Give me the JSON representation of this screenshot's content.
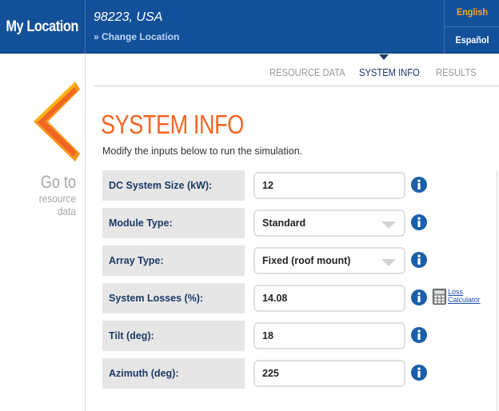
{
  "header": {
    "brand": "My Location",
    "location": "98223, USA",
    "change_location": "» Change Location",
    "languages": [
      "English",
      "Español"
    ]
  },
  "nav": {
    "back_big": "Go to",
    "back_small_1": "resource",
    "back_small_2": "data"
  },
  "tabs": [
    {
      "label": "RESOURCE DATA",
      "active": false
    },
    {
      "label": "SYSTEM INFO",
      "active": true
    },
    {
      "label": "RESULTS",
      "active": false
    }
  ],
  "main": {
    "title": "SYSTEM INFO",
    "subtitle": "Modify the inputs below to run the simulation.",
    "rows": [
      {
        "label": "DC System Size (kW):",
        "value": "12",
        "kind": "input"
      },
      {
        "label": "Module Type:",
        "value": "Standard",
        "kind": "select"
      },
      {
        "label": "Array Type:",
        "value": "Fixed (roof mount)",
        "kind": "select"
      },
      {
        "label": "System Losses (%):",
        "value": "14.08",
        "kind": "input"
      },
      {
        "label": "Tilt (deg):",
        "value": "18",
        "kind": "input"
      },
      {
        "label": "Azimuth (deg):",
        "value": "225",
        "kind": "input"
      }
    ],
    "loss_calc_line1": "Loss",
    "loss_calc_line2": "Calculator"
  },
  "colors": {
    "header_bg": "#13509a",
    "accent_orange": "#f26522",
    "label_text": "#1b3a66",
    "info_icon": "#1b5fa8"
  }
}
